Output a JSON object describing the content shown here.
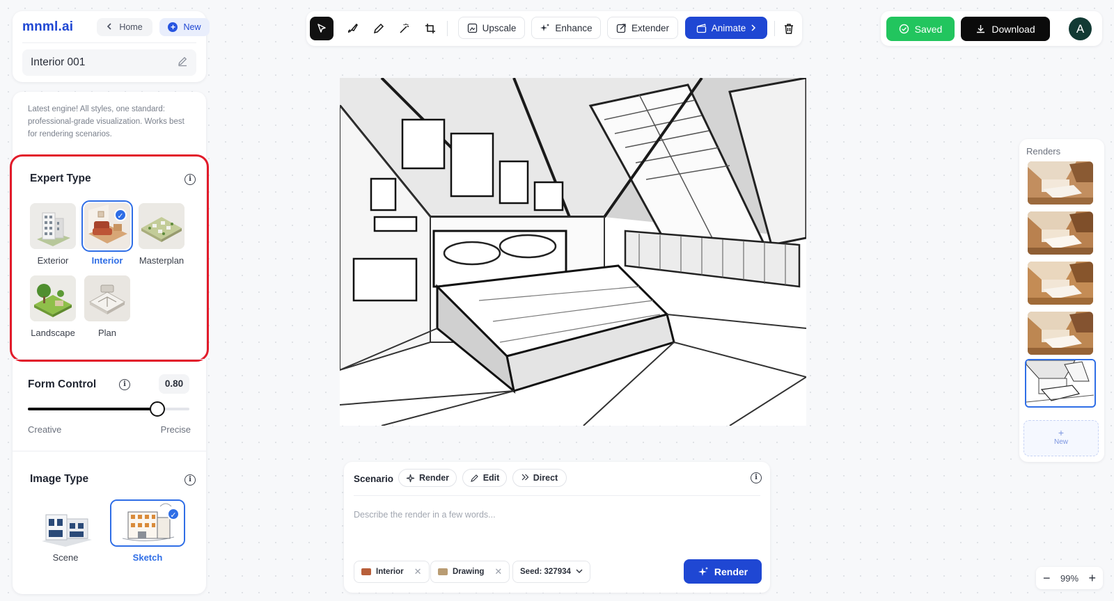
{
  "header": {
    "logo": "mnml.ai",
    "home_label": "Home",
    "new_label": "New",
    "project_name": "Interior 001"
  },
  "panel": {
    "description": "Latest engine! All styles, one standard: professional-grade visualization. Works best for rendering scenarios.",
    "expert_type": {
      "title": "Expert Type",
      "options": [
        {
          "label": "Exterior",
          "selected": false
        },
        {
          "label": "Interior",
          "selected": true
        },
        {
          "label": "Masterplan",
          "selected": false
        },
        {
          "label": "Landscape",
          "selected": false
        },
        {
          "label": "Plan",
          "selected": false
        }
      ]
    },
    "form_control": {
      "title": "Form Control",
      "value": "0.80",
      "level": 0.8,
      "min_label": "Creative",
      "max_label": "Precise"
    },
    "image_type": {
      "title": "Image Type",
      "options": [
        {
          "label": "Scene",
          "selected": false
        },
        {
          "label": "Sketch",
          "selected": true
        }
      ]
    }
  },
  "toolbar": {
    "upscale": "Upscale",
    "enhance": "Enhance",
    "extender": "Extender",
    "animate": "Animate"
  },
  "actions": {
    "saved": "Saved",
    "download": "Download",
    "avatar_initial": "A"
  },
  "renders": {
    "title": "Renders",
    "new_label": "New",
    "count": 5,
    "selected_index": 4
  },
  "prompt": {
    "scenario_label": "Scenario",
    "mode_render": "Render",
    "mode_edit": "Edit",
    "mode_direct": "Direct",
    "placeholder": "Describe the render in a few words...",
    "tag_interior": "Interior",
    "tag_drawing": "Drawing",
    "seed": "Seed: 327934",
    "render_button": "Render"
  },
  "zoom": {
    "level": "99%"
  },
  "colors": {
    "brand": "#1f47d3",
    "accent": "#2f6ee6",
    "success": "#22c55e",
    "highlight": "#e21b2a"
  }
}
